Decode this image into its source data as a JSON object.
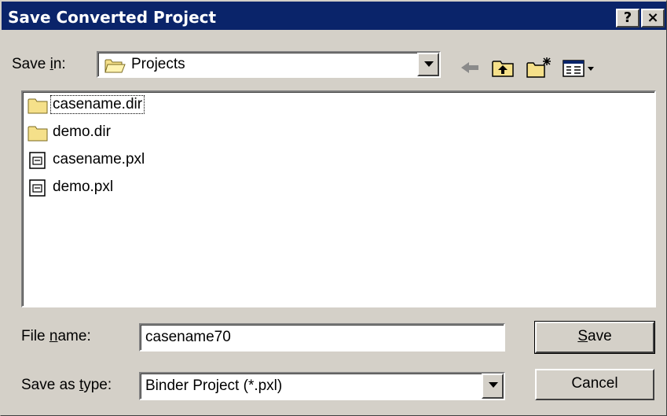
{
  "window": {
    "title": "Save Converted Project",
    "help_label": "?",
    "close_label": "×"
  },
  "save_in": {
    "label_prefix": "Save ",
    "label_accel": "i",
    "label_suffix": "n:",
    "value": "Projects"
  },
  "file_list": {
    "items": [
      {
        "label": "casename.dir",
        "icon": "folder-icon"
      },
      {
        "label": "demo.dir",
        "icon": "folder-icon"
      },
      {
        "label": "casename.pxl",
        "icon": "file-icon"
      },
      {
        "label": "demo.pxl",
        "icon": "file-icon"
      }
    ]
  },
  "file_name": {
    "label_prefix": "File ",
    "label_accel": "n",
    "label_suffix": "ame:",
    "value": "casename70"
  },
  "save_as_type": {
    "label_prefix": "Save as ",
    "label_accel": "t",
    "label_suffix": "ype:",
    "value": "Binder Project (*.pxl)"
  },
  "buttons": {
    "save_accel": "S",
    "save_rest": "ave",
    "cancel": "Cancel"
  }
}
